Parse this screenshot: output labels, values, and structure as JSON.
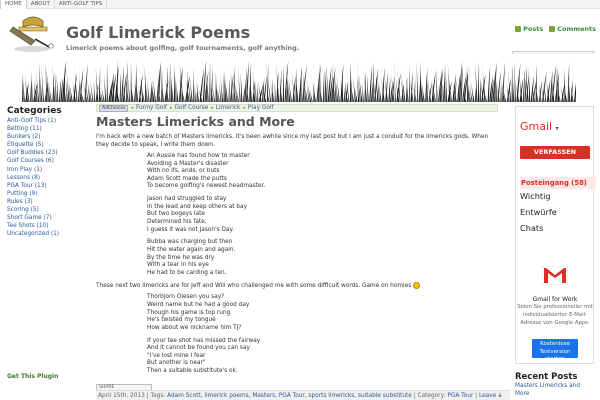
{
  "topnav": {
    "items": [
      "HOME",
      "ABOUT",
      "ANTI-GOLF TIPS"
    ]
  },
  "header": {
    "site_title": "Golf Limerick Poems",
    "tagline": "Limerick poems about golfing, golf tournaments, golf anything.",
    "feeds": {
      "posts": "Posts",
      "comments": "Comments"
    }
  },
  "sidebar": {
    "categories_title": "Categories",
    "categories": [
      "Anti-Golf Tips (1)",
      "Betting (11)",
      "Bunkers (2)",
      "Etiquette (5)",
      "Golf Buddies (23)",
      "Golf Courses (6)",
      "Iron Play (1)",
      "Lessons (8)",
      "PGA Tour (13)",
      "Putting (9)",
      "Rules (3)",
      "Scoring (5)",
      "Short Game (7)",
      "Tee Shots (10)",
      "Uncategorized (1)"
    ],
    "get_plugin": "Get This Plugin"
  },
  "breadcrumb": {
    "adchoices": "AdChoices",
    "links": [
      "Funny Golf",
      "Golf Course",
      "Limerick",
      "Play Golf"
    ]
  },
  "post": {
    "title": "Masters Limericks and More",
    "intro": "I'm back with a new batch of Masters limericks. It's been awhile since my last post but I am just a conduit for the limericks gods. When they decide to speak, I write them down.",
    "poem1": [
      [
        "An Aussie has found how to master",
        "Avoiding a Master's disaster",
        "With no ifs, ands, or buts",
        "Adam Scott made the putts",
        "To become golfing's newest headmaster."
      ],
      [
        "Jason had struggled to stay",
        "In the lead and keep others at bay",
        "But two bogeys late",
        "Determined his fate,",
        "I guess it was not Jason's Day."
      ],
      [
        "Bubba was charging but then",
        "Hit the water again and again.",
        "By the time he was dry",
        "With a tear in his eye",
        "He had to be carding a ten."
      ]
    ],
    "mid_para": "These next two limericks are for Jeff and Will who challenged me with some difficult words. Game on homies",
    "poem2": [
      [
        "Thorbjorn Olesen you say?",
        "Weird name but he had a good day",
        "Though his game is top rung",
        "He's twisted my tongue",
        "How about we nickname him TJ?"
      ],
      [
        "If your tee shot has missed the fairway",
        "And it cannot be found you can say",
        "\"I've lost mine I fear",
        "But another is near\"",
        "Then a suitable substitute's ok."
      ]
    ],
    "share_label": "SHARE",
    "meta": {
      "date": "April 15th, 2013",
      "tags_label": "Tags:",
      "tags": [
        "Adam Scott",
        "limerick poems",
        "Masters",
        "PGA Tour",
        "sports limericks",
        "suitable substitute"
      ],
      "category_label": "Category:",
      "category": "PGA Tour",
      "leave": "Leave a"
    }
  },
  "ad": {
    "logo": "Gmail",
    "compose": "VERFASSEN",
    "items": [
      "Posteingang (58)",
      "Wichtig",
      "Entwürfe",
      "Chats"
    ],
    "gfw": "Gmail for Work",
    "description": "Seien Sie professioneller mit individualisierter E-Mail-Adresse von Google Apps.",
    "cta": "Kostenlose Testversion starten",
    "colors": {
      "red": "#d93025",
      "blue": "#1a73e8"
    }
  },
  "recent": {
    "title": "Recent Posts",
    "items": [
      "Masters Limericks and More"
    ]
  }
}
